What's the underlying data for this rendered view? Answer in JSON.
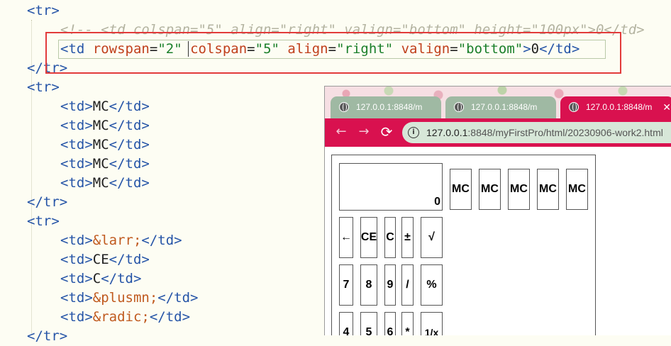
{
  "editor": {
    "lines": [
      {
        "kind": "tag",
        "text": "<tr>"
      },
      {
        "kind": "comment",
        "text": "<!-- <td colspan=\"5\" align=\"right\" valign=\"bottom\" height=\"100px\">0</td>"
      },
      {
        "kind": "td-attrs",
        "open": "<td",
        "attrs": [
          {
            "name": "rowspan",
            "value": "\"2\""
          },
          {
            "name": "colspan",
            "value": "\"5\""
          },
          {
            "name": "align",
            "value": "\"right\""
          },
          {
            "name": "valign",
            "value": "\"bottom\""
          }
        ],
        "close": ">",
        "text": "0",
        "end": "</td>"
      },
      {
        "kind": "tag",
        "text": "</tr>"
      },
      {
        "kind": "tag",
        "text": "<tr>"
      },
      {
        "kind": "td",
        "text": "MC"
      },
      {
        "kind": "td",
        "text": "MC"
      },
      {
        "kind": "td",
        "text": "MC"
      },
      {
        "kind": "td",
        "text": "MC"
      },
      {
        "kind": "td",
        "text": "MC"
      },
      {
        "kind": "tag",
        "text": "</tr>"
      },
      {
        "kind": "tag",
        "text": "<tr>"
      },
      {
        "kind": "td-entity",
        "text": "&larr;"
      },
      {
        "kind": "td",
        "text": "CE"
      },
      {
        "kind": "td",
        "text": "C"
      },
      {
        "kind": "td-entity",
        "text": "&plusmn;"
      },
      {
        "kind": "td-entity",
        "text": "&radic;"
      },
      {
        "kind": "tag",
        "text": "</tr>"
      }
    ]
  },
  "browser": {
    "tabs": [
      {
        "title": "127.0.0.1:8848/m",
        "active": false
      },
      {
        "title": "127.0.0.1:8848/m",
        "active": false
      },
      {
        "title": "127.0.0.1:8848/m",
        "active": true
      }
    ],
    "tab_close_glyph": "✕",
    "url_host": "127.0.0.1",
    "url_rest": ":8848/myFirstPro/html/20230906-work2.html",
    "nav": {
      "back": "←",
      "forward": "→",
      "reload": "⟳",
      "info": "i"
    }
  },
  "calculator": {
    "display": "0",
    "memory_row": [
      "MC",
      "MC",
      "MC",
      "MC",
      "MC"
    ],
    "rows": [
      [
        "←",
        "CE",
        "C",
        "±",
        "√"
      ],
      [
        "7",
        "8",
        "9",
        "/",
        "%"
      ],
      [
        "4",
        "5",
        "6",
        "*",
        "1/x"
      ]
    ]
  },
  "colors": {
    "browser_accent": "#d9114f",
    "inactive_tab": "#9fb9a3",
    "highlight_border": "#e23b3b",
    "editor_background": "#fdfdf3"
  }
}
